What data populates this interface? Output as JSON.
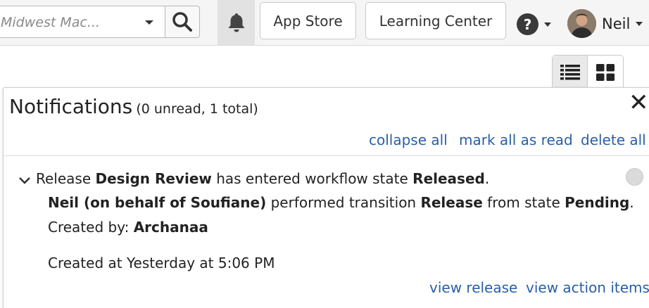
{
  "header": {
    "document_select": {
      "value": "Midwest Mac..."
    },
    "app_store_label": "App Store",
    "learning_center_label": "Learning Center",
    "help_symbol": "?",
    "user_name": "Neil"
  },
  "notifications": {
    "title": "Notifications",
    "counts": "(0 unread, 1 total)",
    "close_symbol": "✕",
    "actions": {
      "collapse_all": "collapse all",
      "mark_all_read": "mark all as read",
      "delete_all": "delete all"
    },
    "items": [
      {
        "line1": {
          "prefix": "Release ",
          "name": "Design Review",
          "middle": " has entered workflow state ",
          "state": "Released",
          "suffix": "."
        },
        "line2": {
          "actor": "Neil (on behalf of Soufiane)",
          "middle": " performed transition ",
          "transition": "Release",
          "middle2": " from state ",
          "from_state": "Pending",
          "suffix": "."
        },
        "line3": {
          "label": "Created by: ",
          "creator": "Archanaa"
        },
        "created_at": "Created at Yesterday at 5:06 PM",
        "links": {
          "view_release": "view release",
          "view_action_items": "view action items"
        }
      }
    ]
  },
  "icons": {
    "search": "search-icon",
    "bell": "bell-icon",
    "list_view": "list-view-icon",
    "grid_view": "grid-view-icon",
    "chevron": "chevron-down-icon"
  }
}
